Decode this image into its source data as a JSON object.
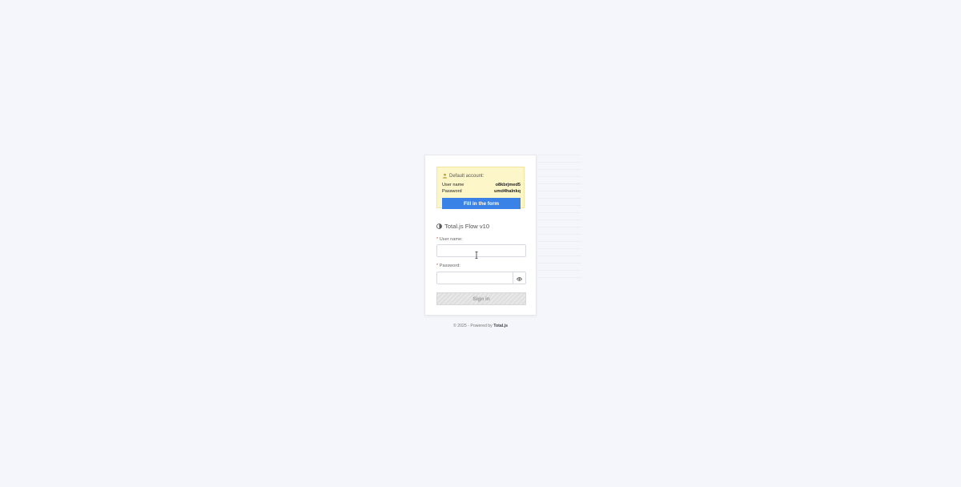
{
  "notice": {
    "heading": "Default account:",
    "username_label": "User name",
    "username_value": "o8kbrjmed5",
    "password_label": "Password",
    "password_value": "umd4halnkq",
    "fill_button": "Fill in the form"
  },
  "app": {
    "title": "Total.js Flow v10"
  },
  "form": {
    "username_label": "User name:",
    "username_value": "",
    "password_label": "Password:",
    "password_value": "",
    "required_mark": "*",
    "signin_button": "Sign in"
  },
  "footer": {
    "prefix": "© 2025 - Powered by",
    "brand": "Total.js"
  },
  "colors": {
    "background": "#f4f6fb",
    "notice_bg": "#fdf6c8",
    "accent": "#3b82e6",
    "required": "#e04848"
  },
  "icons": {
    "notice": "user-icon",
    "logo": "totaljs-logo-icon",
    "password_toggle": "eye-icon"
  }
}
